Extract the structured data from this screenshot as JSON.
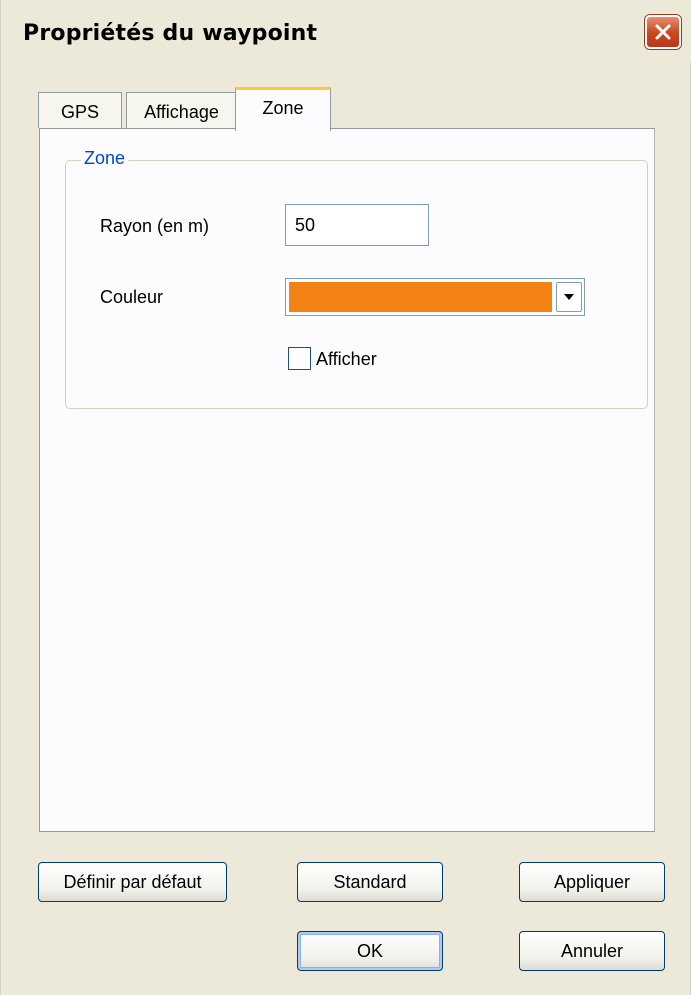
{
  "window": {
    "title": "Propriétés du waypoint"
  },
  "tabs": [
    {
      "label": "GPS",
      "active": false
    },
    {
      "label": "Affichage",
      "active": false
    },
    {
      "label": "Zone",
      "active": true
    }
  ],
  "zone_group": {
    "legend": "Zone",
    "radius": {
      "label": "Rayon (en m)",
      "value": "50"
    },
    "color": {
      "label": "Couleur",
      "selected_color": "#f28214"
    },
    "show": {
      "label": "Afficher",
      "checked": false
    }
  },
  "buttons": {
    "set_default": "Définir par défaut",
    "standard": "Standard",
    "apply": "Appliquer",
    "ok": "OK",
    "cancel": "Annuler"
  },
  "colors": {
    "legend_blue": "#0046d5",
    "close_red": "#c9461f",
    "tab_highlight": "#ffc83c"
  }
}
